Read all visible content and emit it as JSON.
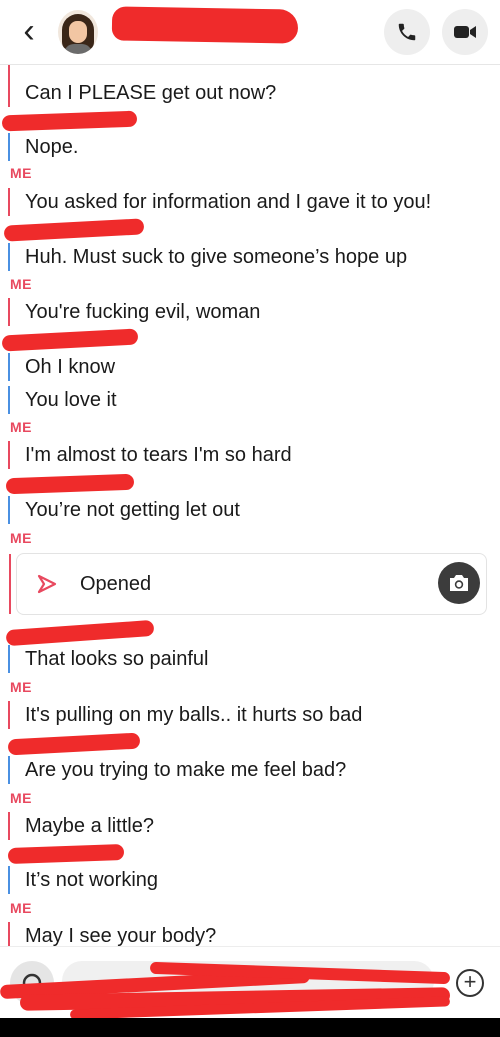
{
  "header": {
    "back_icon": "‹",
    "avatar_icon": "bitmoji-avatar",
    "contact_name": ""
  },
  "labels": {
    "me": "ME"
  },
  "messages": [
    {
      "sender": "ME",
      "text": "Can I PLEASE get out now?"
    },
    {
      "sender": "them",
      "text": "Nope."
    },
    {
      "sender": "ME",
      "text": "You asked for information and I gave it to you!"
    },
    {
      "sender": "them",
      "text": "Huh. Must suck to give someone’s hope up"
    },
    {
      "sender": "ME",
      "text": "You're fucking evil, woman"
    },
    {
      "sender": "them",
      "text": "Oh I know"
    },
    {
      "sender": "them",
      "text": "You love it"
    },
    {
      "sender": "ME",
      "text": "I'm almost to tears I'm so hard"
    },
    {
      "sender": "them",
      "text": "You’re not getting let out"
    },
    {
      "sender": "ME",
      "text": "Opened",
      "type": "snap"
    },
    {
      "sender": "them",
      "text": "That looks so painful"
    },
    {
      "sender": "ME",
      "text": "It's pulling on my balls.. it hurts so bad"
    },
    {
      "sender": "them",
      "text": "Are you trying to make me feel bad?"
    },
    {
      "sender": "ME",
      "text": "Maybe a little?"
    },
    {
      "sender": "them",
      "text": "It’s not working"
    },
    {
      "sender": "ME",
      "text": "May I see your body?"
    }
  ],
  "snap": {
    "status": "Opened"
  },
  "composer": {
    "placeholder": "",
    "plus_icon": "+"
  },
  "colors": {
    "me_accent": "#e8495f",
    "them_accent": "#4a90e2",
    "redaction": "#ef2b2b"
  }
}
